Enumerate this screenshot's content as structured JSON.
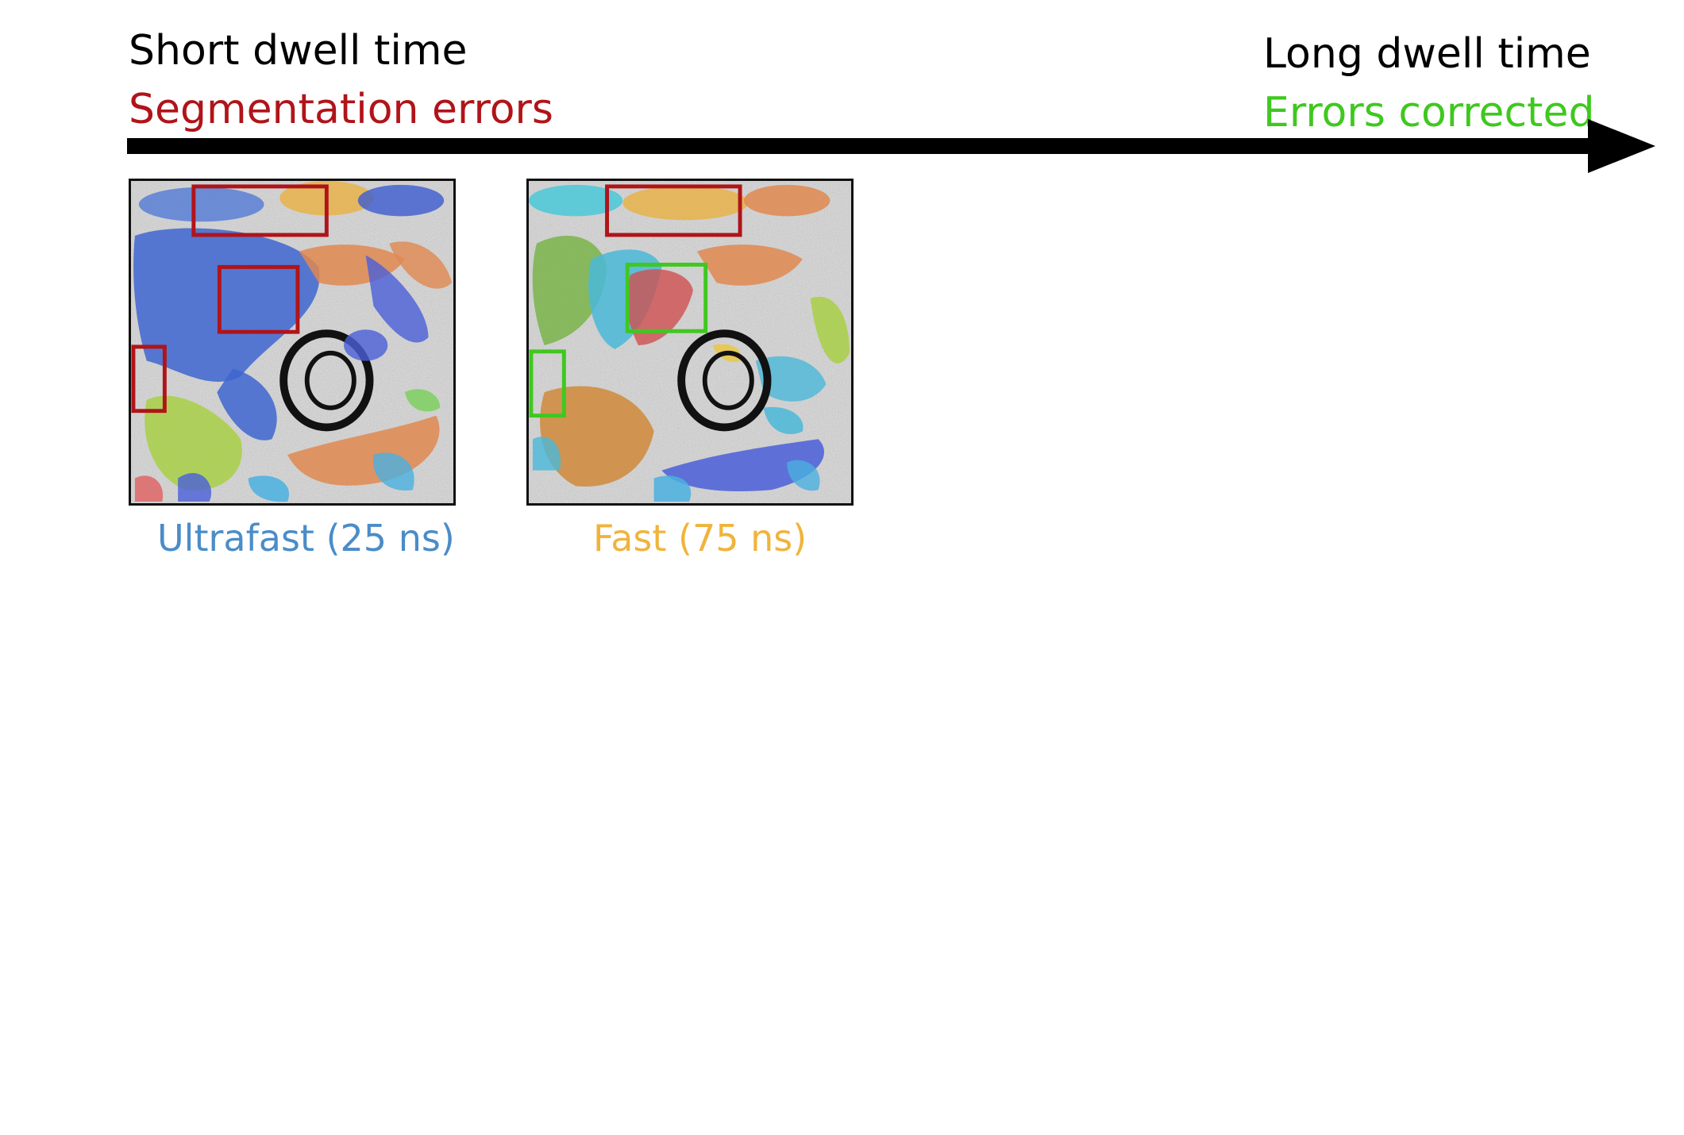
{
  "header": {
    "left_title": "Short dwell time",
    "left_subtitle": "Segmentation errors",
    "right_title": "Long dwell time",
    "right_subtitle": "Errors corrected"
  },
  "panels": [
    {
      "caption": "Ultrafast (25 ns)"
    },
    {
      "caption": "Fast (75 ns)"
    }
  ],
  "colors": {
    "error_box": "#b01419",
    "corrected_box": "#3fc81f",
    "ultrafast_caption": "#4b8cc8",
    "fast_caption": "#f0b43c"
  }
}
